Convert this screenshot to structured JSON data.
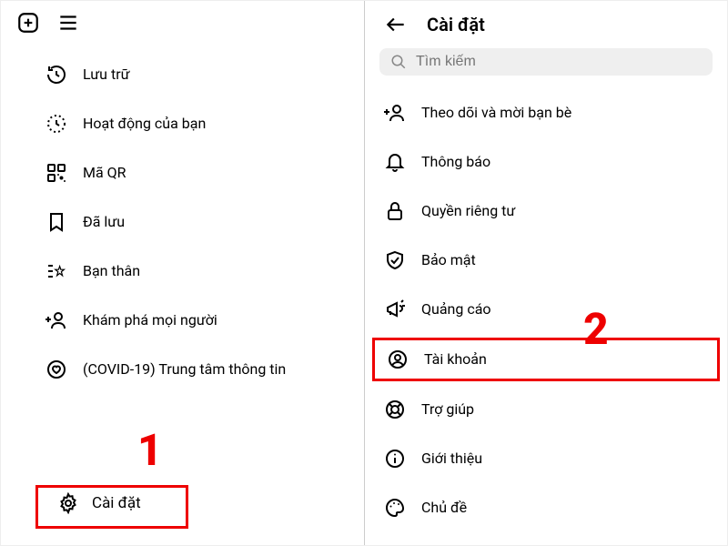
{
  "left": {
    "menu": [
      {
        "label": "Lưu trữ"
      },
      {
        "label": "Hoạt động của bạn"
      },
      {
        "label": "Mã QR"
      },
      {
        "label": "Đã lưu"
      },
      {
        "label": "Bạn thân"
      },
      {
        "label": "Khám phá mọi người"
      },
      {
        "label": "(COVID-19) Trung tâm thông tin"
      }
    ],
    "settings_label": "Cài đặt"
  },
  "right": {
    "title": "Cài đặt",
    "search_placeholder": "Tìm kiếm",
    "items": [
      {
        "label": "Theo dõi và mời bạn bè"
      },
      {
        "label": "Thông báo"
      },
      {
        "label": "Quyền riêng tư"
      },
      {
        "label": "Bảo mật"
      },
      {
        "label": "Quảng cáo"
      },
      {
        "label": "Tài khoản"
      },
      {
        "label": "Trợ giúp"
      },
      {
        "label": "Giới thiệu"
      },
      {
        "label": "Chủ đề"
      }
    ]
  },
  "callouts": {
    "one": "1",
    "two": "2"
  }
}
